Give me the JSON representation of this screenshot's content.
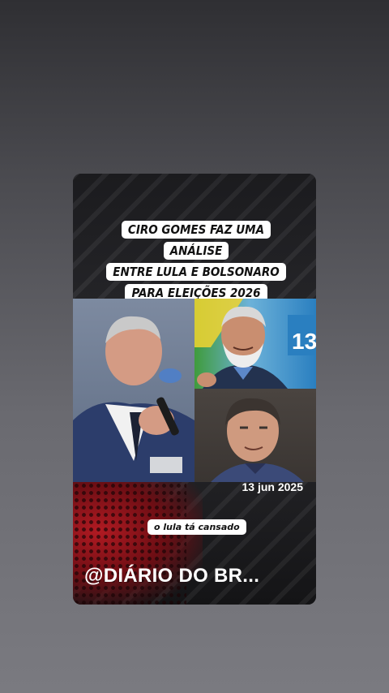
{
  "story": {
    "headline": [
      "CIRO GOMES FAZ UMA ANÁLISE",
      "ENTRE  LULA E BOLSONARO",
      "PARA ELEIÇÕES 2026"
    ],
    "date_label": "13 jun 2025",
    "caption": "o lula tá cansado",
    "handle": "@DIÁRIO DO BR...",
    "backdrop_number": "13"
  },
  "photos": [
    {
      "name": "ciro-gomes-photo",
      "subject": "Ciro Gomes speaking into microphone"
    },
    {
      "name": "lula-photo",
      "subject": "Lula smiling"
    },
    {
      "name": "bolsonaro-photo",
      "subject": "Bolsonaro portrait"
    }
  ],
  "colors": {
    "accent_red": "#b11a22",
    "card_bg": "#151517",
    "label_bg": "#ffffff"
  }
}
